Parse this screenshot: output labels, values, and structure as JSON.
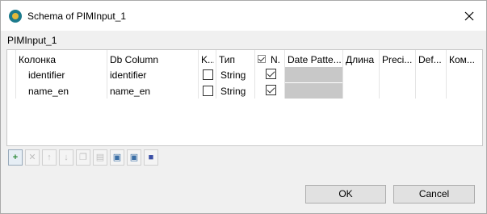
{
  "window": {
    "title": "Schema of PIMInput_1"
  },
  "section": {
    "label": "PIMInput_1"
  },
  "table": {
    "columns": [
      "Колонка",
      "Db Column",
      "K...",
      "Тип",
      "N.",
      "Date Patte...",
      "Длина",
      "Preci...",
      "Def...",
      "Ком..."
    ],
    "rows": [
      {
        "column": "identifier",
        "db_column": "identifier",
        "key": false,
        "type": "String",
        "nullable": true
      },
      {
        "column": "name_en",
        "db_column": "name_en",
        "key": false,
        "type": "String",
        "nullable": true
      }
    ]
  },
  "toolbar": {
    "buttons": [
      "add-icon",
      "remove-icon",
      "move-up-icon",
      "move-down-icon",
      "copy-icon",
      "paste-icon",
      "import-icon",
      "export-icon",
      "save-icon"
    ]
  },
  "buttons": {
    "ok": "OK",
    "cancel": "Cancel"
  },
  "colors": {
    "accent": "#1c7a8c",
    "add_icon": "#2e8b3a",
    "grey_cell": "#c8c8c8"
  }
}
